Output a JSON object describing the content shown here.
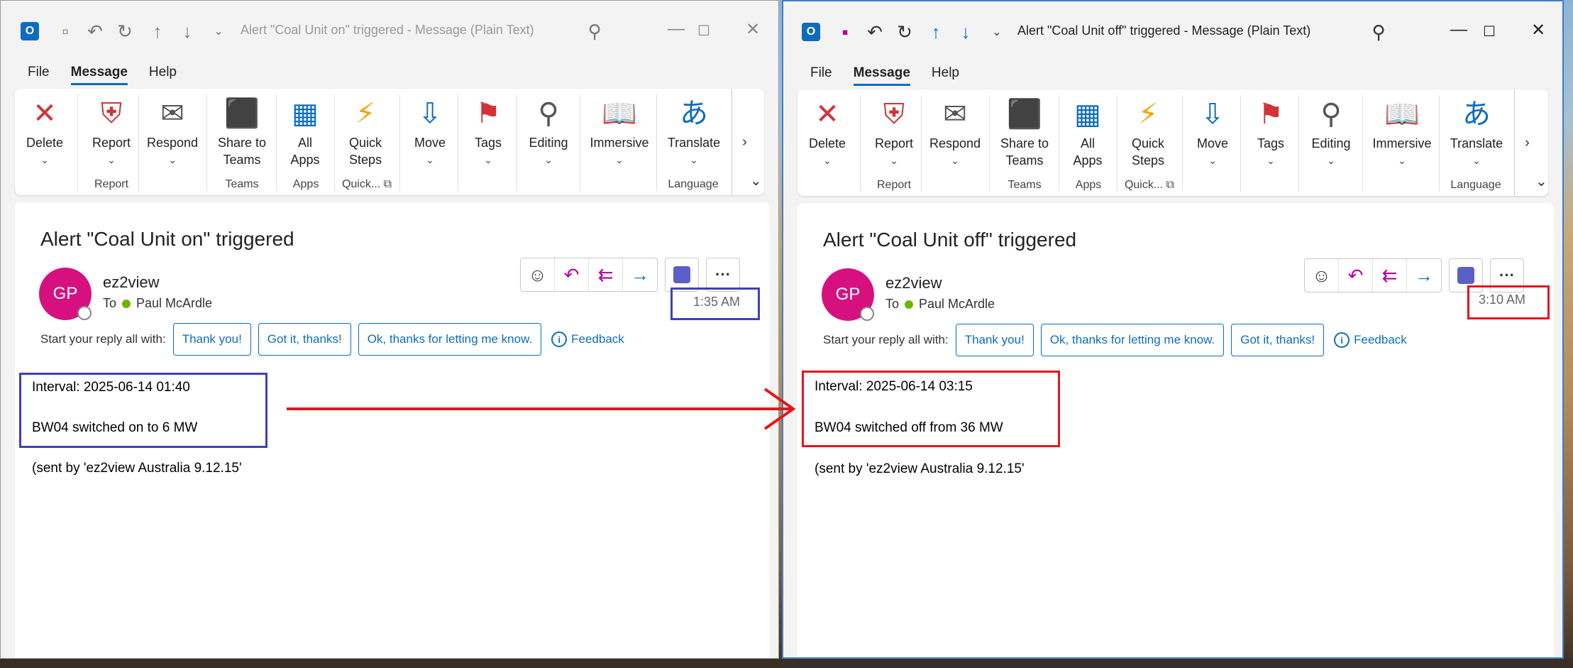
{
  "left_window": {
    "title": "Alert \"Coal Unit on\" triggered  -  Message (Plain Text)",
    "subject": "Alert \"Coal Unit on\" triggered",
    "sender": "ez2view",
    "time": "1:35 AM",
    "reply_chips": [
      "Thank you!",
      "Got it, thanks!",
      "Ok, thanks for letting me know."
    ],
    "body": {
      "interval": "Interval: 2025-06-14 01:40",
      "status": "BW04 switched on to 6 MW",
      "sent_by": "(sent by 'ez2view Australia 9.12.15'"
    }
  },
  "right_window": {
    "title": "Alert \"Coal Unit off\" triggered  -  Message (Plain Text)",
    "subject": "Alert \"Coal Unit off\" triggered",
    "sender": "ez2view",
    "time": "3:10 AM",
    "reply_chips": [
      "Thank you!",
      "Ok, thanks for letting me know.",
      "Got it, thanks!"
    ],
    "body": {
      "interval": "Interval: 2025-06-14 03:15",
      "status": "BW04 switched off from 36 MW",
      "sent_by": "(sent by 'ez2view Australia 9.12.15'"
    }
  },
  "shared": {
    "menu": [
      "File",
      "Message",
      "Help"
    ],
    "ribbon": {
      "delete": "Delete",
      "report": "Report",
      "respond": "Respond",
      "share_line1": "Share to",
      "share_line2": "Teams",
      "allapps_line1": "All",
      "allapps_line2": "Apps",
      "quick_line1": "Quick",
      "quick_line2": "Steps",
      "move": "Move",
      "tags": "Tags",
      "editing": "Editing",
      "immersive": "Immersive",
      "translate": "Translate",
      "groups": {
        "report": "Report",
        "teams": "Teams",
        "apps": "Apps",
        "quick": "Quick...",
        "language": "Language"
      }
    },
    "avatar_initials": "GP",
    "to_label": "To",
    "recipient": "Paul McArdle",
    "reply_prompt": "Start your reply all with:",
    "feedback": "Feedback"
  },
  "colors": {
    "accent": "#0f6cbd",
    "avatar": "#d6117f",
    "highlight_left": "#3f3fbf",
    "highlight_right": "#e3161b",
    "arrow": "#e3161b"
  }
}
